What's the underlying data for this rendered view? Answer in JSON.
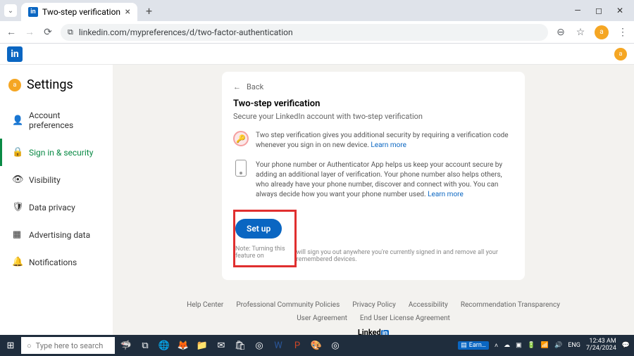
{
  "browser": {
    "tab_title": "Two-step verification",
    "url": "linkedin.com/mypreferences/d/two-factor-authentication"
  },
  "header": {
    "logo": "in",
    "avatar": "a"
  },
  "sidebar": {
    "avatar": "a",
    "title": "Settings",
    "items": [
      {
        "icon": "👤",
        "label": "Account preferences"
      },
      {
        "icon": "🔒",
        "label": "Sign in & security"
      },
      {
        "icon": "👁",
        "label": "Visibility"
      },
      {
        "icon": "🛡",
        "label": "Data privacy"
      },
      {
        "icon": "▦",
        "label": "Advertising data"
      },
      {
        "icon": "🔔",
        "label": "Notifications"
      }
    ]
  },
  "card": {
    "back": "Back",
    "title": "Two-step verification",
    "subtitle": "Secure your LinkedIn account with two-step verification",
    "info1": "Two step verification gives you additional security by requiring a verification code whenever you sign in on new device. ",
    "learn": "Learn more",
    "info2": "Your phone number or Authenticator App helps us keep your account secure by adding an additional layer of verification. Your phone number also helps others, who already have your phone number, discover and connect with you. You can always decide how you want your phone number used. ",
    "setup": "Set up",
    "note_head": "Note: Turning this feature on",
    "note_tail": " will sign you out anywhere you're currently signed in and remove all your remembered devices."
  },
  "footer": {
    "r1": [
      "Help Center",
      "Professional Community Policies",
      "Privacy Policy",
      "Accessibility",
      "Recommendation Transparency"
    ],
    "r2": [
      "User Agreement",
      "End User License Agreement"
    ],
    "brand": "Linked"
  },
  "taskbar": {
    "search_placeholder": "Type here to search",
    "badge": "Earn…",
    "lang": "ENG",
    "time": "12:43 AM",
    "date": "7/24/2024"
  }
}
